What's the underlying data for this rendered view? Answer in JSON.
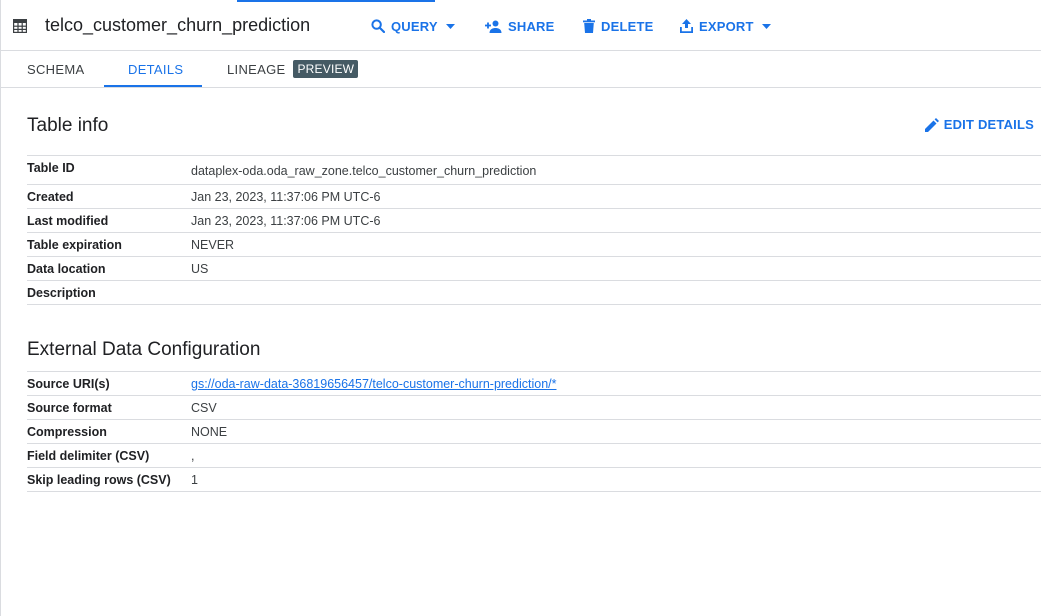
{
  "header": {
    "title": "telco_customer_churn_prediction",
    "icon": "table-icon",
    "actions": {
      "query": "QUERY",
      "share": "SHARE",
      "delete": "DELETE",
      "export": "EXPORT"
    }
  },
  "tabs": {
    "schema": "SCHEMA",
    "details": "DETAILS",
    "lineage": "LINEAGE",
    "lineage_badge": "PREVIEW",
    "active": "DETAILS"
  },
  "table_info": {
    "title": "Table info",
    "edit_label": "EDIT DETAILS",
    "rows": [
      {
        "key": "Table ID",
        "value": "dataplex-oda.oda_raw_zone.telco_customer_churn_prediction"
      },
      {
        "key": "Created",
        "value": "Jan 23, 2023, 11:37:06 PM UTC-6"
      },
      {
        "key": "Last modified",
        "value": "Jan 23, 2023, 11:37:06 PM UTC-6"
      },
      {
        "key": "Table expiration",
        "value": "NEVER"
      },
      {
        "key": "Data location",
        "value": "US"
      },
      {
        "key": "Description",
        "value": ""
      }
    ]
  },
  "external_config": {
    "title": "External Data Configuration",
    "rows": [
      {
        "key": "Source URI(s)",
        "value": "gs://oda-raw-data-36819656457/telco-customer-churn-prediction/*"
      },
      {
        "key": "Source format",
        "value": "CSV"
      },
      {
        "key": "Compression",
        "value": "NONE"
      },
      {
        "key": "Field delimiter (CSV)",
        "value": ","
      },
      {
        "key": "Skip leading rows (CSV)",
        "value": "1"
      }
    ]
  },
  "colors": {
    "accent": "#1a73e8",
    "badge": "#455a64",
    "divider": "#dadce0"
  }
}
